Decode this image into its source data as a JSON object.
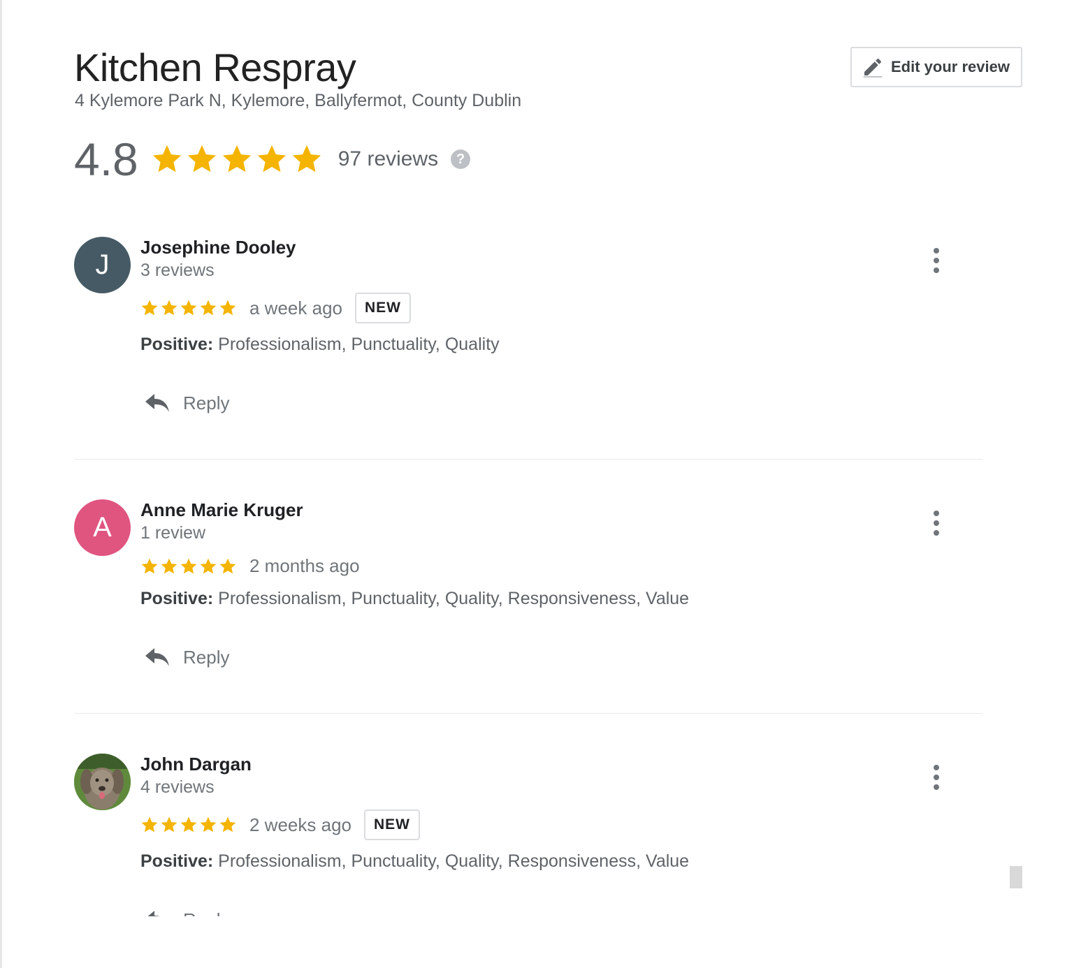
{
  "business": {
    "name": "Kitchen Respray",
    "address": "4 Kylemore Park N, Kylemore, Ballyfermot, County Dublin",
    "rating": "4.8",
    "rating_value": 4.8,
    "rating_max": 5,
    "total_reviews": "97 reviews",
    "help_glyph": "?"
  },
  "edit_button": {
    "label": "Edit your review",
    "icon": "pencil-icon"
  },
  "colors": {
    "star": "#f4b400",
    "avatar_j": "#455a64",
    "avatar_a": "#e05580"
  },
  "reviews": [
    {
      "name": "Josephine Dooley",
      "count": "3 reviews",
      "avatar_letter": "J",
      "stars": 5,
      "time": "a week ago",
      "badge": "NEW",
      "positive_label": "Positive:",
      "positive_text": "Professionalism, Punctuality, Quality",
      "reply_label": "Reply"
    },
    {
      "name": "Anne Marie Kruger",
      "count": "1 review",
      "avatar_letter": "A",
      "stars": 5,
      "time": "2 months ago",
      "badge": "",
      "positive_label": "Positive:",
      "positive_text": "Professionalism, Punctuality, Quality, Responsiveness, Value",
      "reply_label": "Reply"
    },
    {
      "name": "John Dargan",
      "count": "4 reviews",
      "avatar_letter": "",
      "stars": 5,
      "time": "2 weeks ago",
      "badge": "NEW",
      "positive_label": "Positive:",
      "positive_text": "Professionalism, Punctuality, Quality, Responsiveness, Value",
      "reply_label": "Reply"
    }
  ]
}
